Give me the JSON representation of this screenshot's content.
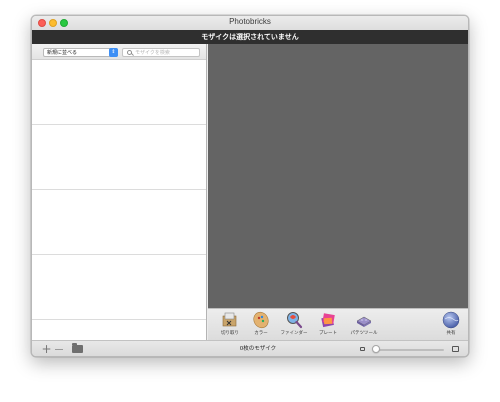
{
  "window": {
    "title": "Photobricks",
    "status_message": "モザイクは選択されていません"
  },
  "sidebar": {
    "sort_label": "新規に並べる",
    "search_placeholder": "モザイクを検索",
    "search_value": ""
  },
  "toolbar": {
    "tools": [
      {
        "label": "切り取り",
        "icon": "crop-icon"
      },
      {
        "label": "カラー",
        "icon": "palette-icon"
      },
      {
        "label": "ファインダー",
        "icon": "magnifier-icon"
      },
      {
        "label": "プレート",
        "icon": "plate-icon"
      },
      {
        "label": "パテツツール",
        "icon": "brick-tool-icon"
      },
      {
        "label": "共有",
        "icon": "share-globe-icon"
      }
    ]
  },
  "footer": {
    "mosaic_count": "0枚のモザイク",
    "zoom_level": 0.03
  },
  "colors": {
    "status_bar": "#2f2f2f",
    "canvas": "#646464",
    "accent": "#3d8ff5"
  }
}
